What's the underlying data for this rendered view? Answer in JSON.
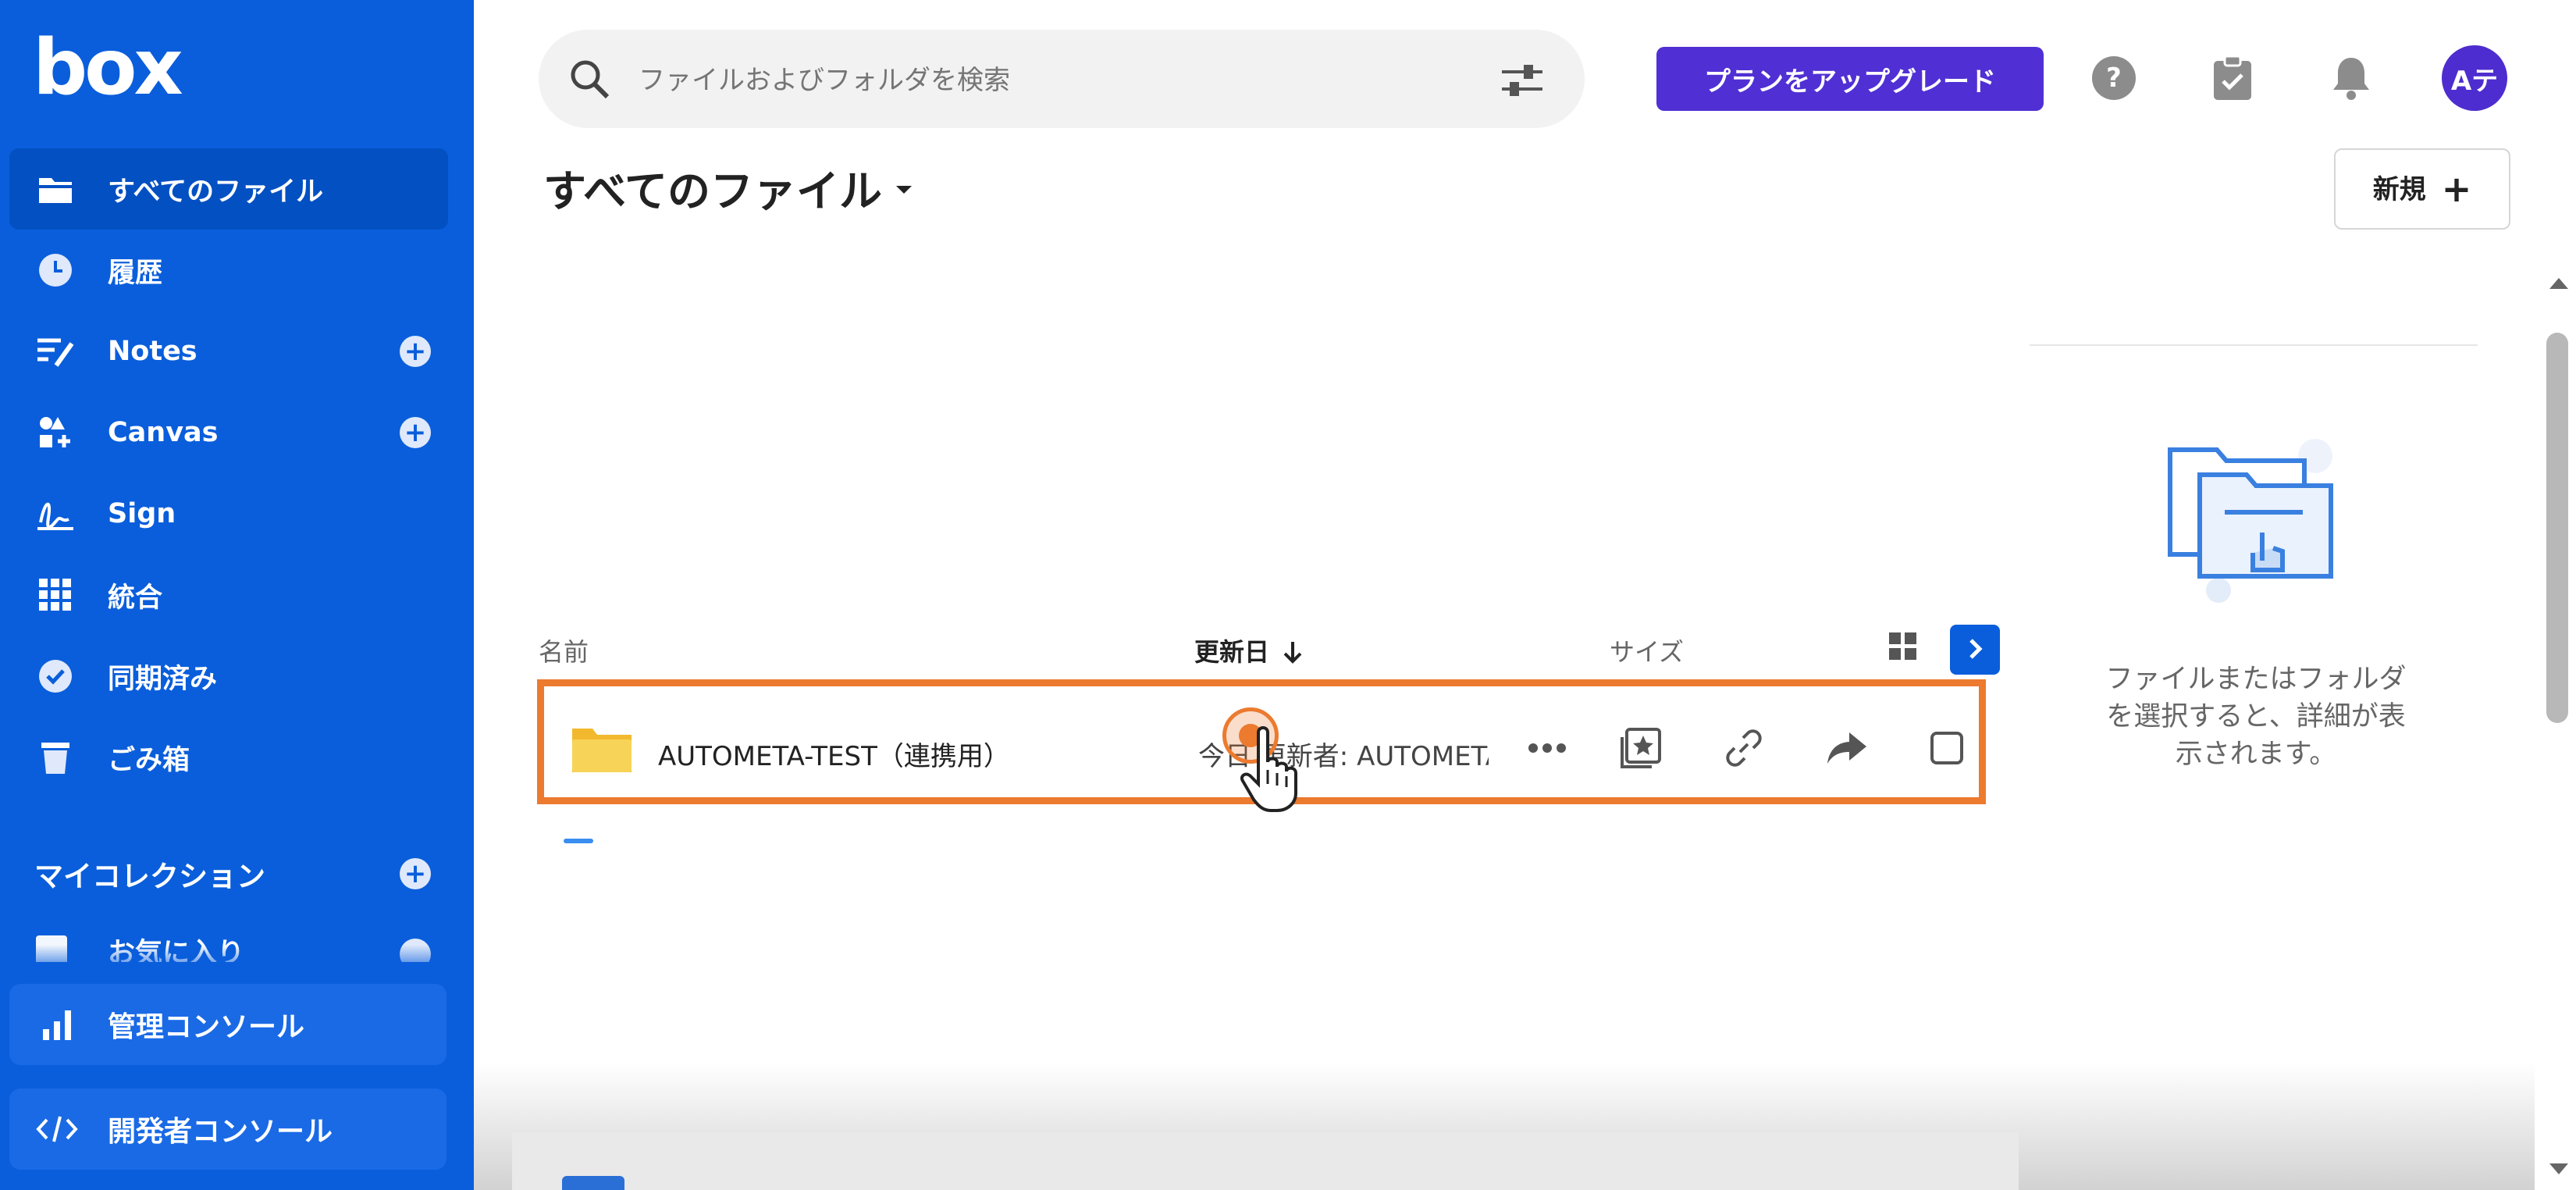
{
  "brand": {
    "logo": "box"
  },
  "sidebar": {
    "items": [
      {
        "label": "すべてのファイル",
        "icon": "folder-icon"
      },
      {
        "label": "履歴",
        "icon": "clock-icon"
      },
      {
        "label": "Notes",
        "icon": "notes-icon"
      },
      {
        "label": "Canvas",
        "icon": "canvas-icon"
      },
      {
        "label": "Sign",
        "icon": "sign-icon"
      },
      {
        "label": "統合",
        "icon": "apps-grid-icon"
      },
      {
        "label": "同期済み",
        "icon": "check-circle-icon"
      },
      {
        "label": "ごみ箱",
        "icon": "trash-icon"
      }
    ],
    "my_collections": "マイコレクション",
    "favorites": "お気に入り",
    "admin_console": "管理コンソール",
    "dev_console": "開発者コンソール"
  },
  "search": {
    "placeholder": "ファイルおよびフォルダを検索"
  },
  "header": {
    "upgrade_label": "プランをアップグレード",
    "avatar_initials": "Aテ"
  },
  "main": {
    "title": "すべてのファイル",
    "new_label": "新規",
    "columns": {
      "name": "名前",
      "updated": "更新日",
      "size": "サイズ"
    },
    "rows": [
      {
        "name": "AUTOMETA-TEST（連携用）",
        "updated": "今日 更新者: AUTOMETA"
      }
    ]
  },
  "details_panel": {
    "message": "ファイルまたはフォルダを選択すると、詳細が表示されます。"
  },
  "colors": {
    "sidebar": "#0a5edb",
    "upgrade": "#5030d4",
    "highlight": "#ec7a2f",
    "folder": "#f7c948"
  }
}
